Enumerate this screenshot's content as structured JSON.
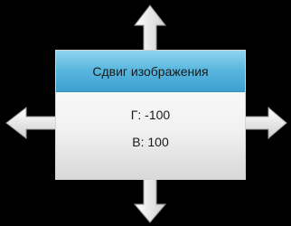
{
  "dialog": {
    "title": "Сдвиг изображения",
    "horizontal": "Г: -100",
    "vertical": "В: 100"
  },
  "arrows": {
    "icons": [
      "arrow-up-icon",
      "arrow-down-icon",
      "arrow-left-icon",
      "arrow-right-icon"
    ],
    "fill": "#e6e6e6",
    "edge": "#9a9a9a"
  },
  "colors": {
    "background": "#000000",
    "header": "#5bb8df",
    "panel": "#f2f2f2",
    "text": "#1a1a1a"
  }
}
